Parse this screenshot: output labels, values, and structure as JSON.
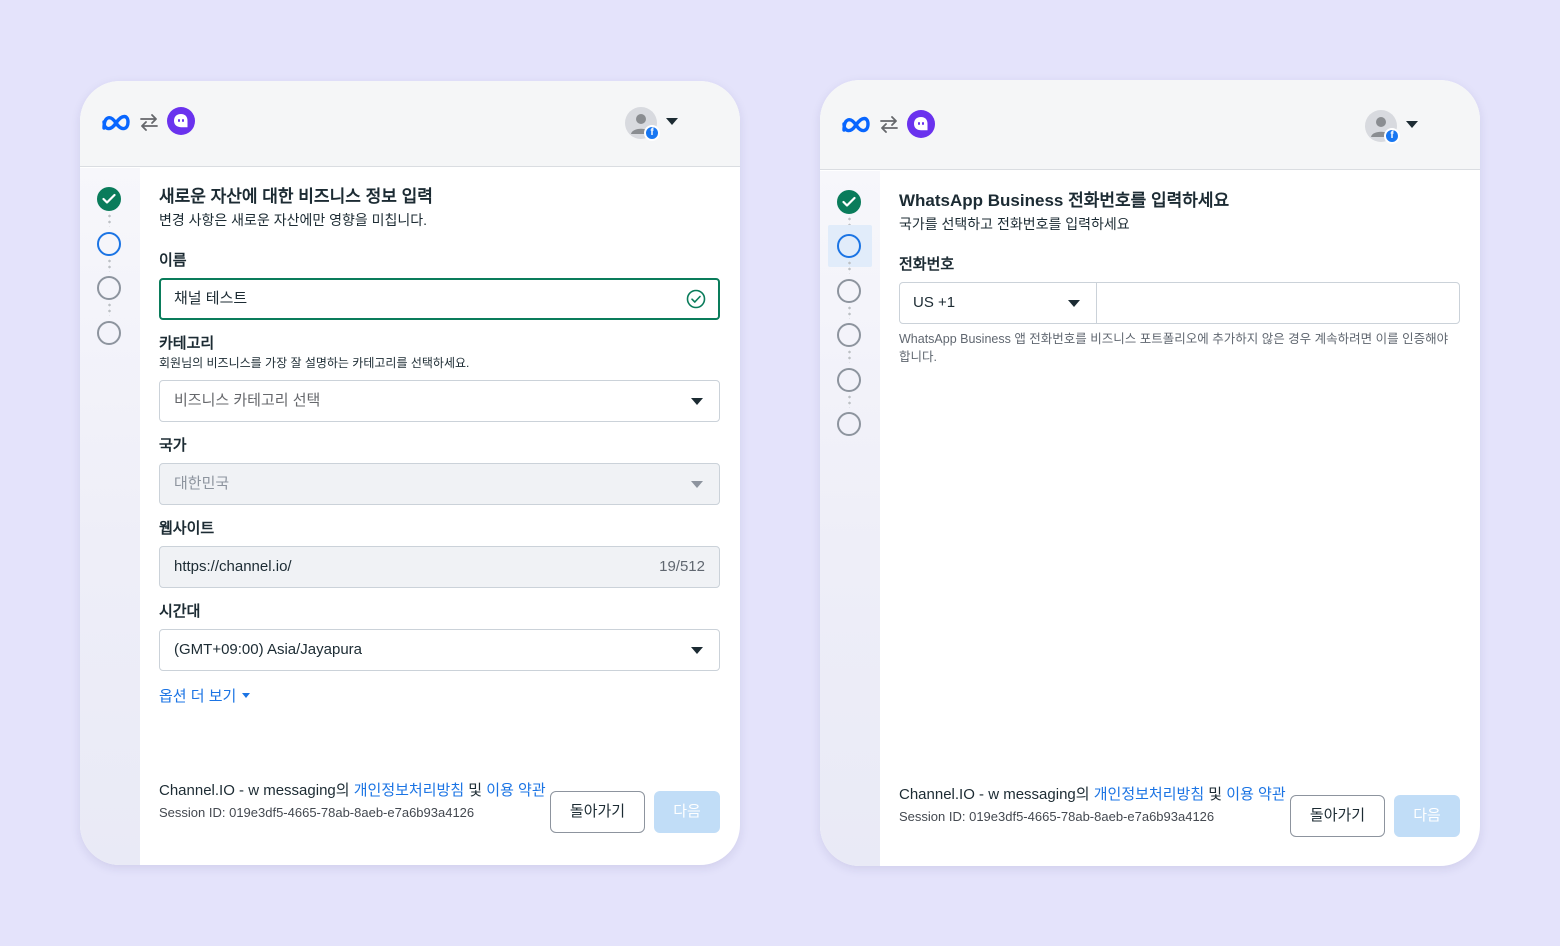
{
  "colors": {
    "background": "#e4e3fb",
    "accent_blue": "#1b74e4",
    "success_green": "#0a7c5b",
    "disabled_button": "#c1ddf7",
    "channel_purple": "#6a32ee"
  },
  "icons": [
    "meta-logo-icon",
    "swap-arrows-icon",
    "channel-talk-icon",
    "account-avatar-icon",
    "facebook-badge-icon",
    "chevron-down-icon",
    "check-circle-icon"
  ],
  "left_window": {
    "stepper": {
      "steps": [
        "done",
        "current",
        "pending",
        "pending"
      ]
    },
    "title": "새로운 자산에 대한 비즈니스 정보 입력",
    "subtitle": "변경 사항은 새로운 자산에만 영향을 미칩니다.",
    "name": {
      "label": "이름",
      "value": "채널 테스트"
    },
    "category": {
      "label": "카테고리",
      "helper": "회원님의 비즈니스를 가장 잘 설명하는 카테고리를 선택하세요.",
      "placeholder": "비즈니스 카테고리 선택"
    },
    "country": {
      "label": "국가",
      "value": "대한민국"
    },
    "website": {
      "label": "웹사이트",
      "value": "https://channel.io/",
      "counter": "19/512"
    },
    "timezone": {
      "label": "시간대",
      "value": "(GMT+09:00) Asia/Jayapura"
    },
    "more_options": "옵션 더 보기",
    "footer": {
      "consent_prefix": "Channel.IO - w messaging의 ",
      "privacy_link": "개인정보처리방침",
      "conjunction": " 및 ",
      "terms_link": "이용 약관",
      "session": "Session ID: 019e3df5-4665-78ab-8aeb-e7a6b93a4126",
      "back_button": "돌아가기",
      "next_button": "다음"
    }
  },
  "right_window": {
    "stepper": {
      "steps": [
        "done",
        "current",
        "pending",
        "pending",
        "pending",
        "pending"
      ]
    },
    "title": "WhatsApp Business 전화번호를 입력하세요",
    "subtitle": "국가를 선택하고 전화번호를 입력하세요",
    "phone": {
      "label": "전화번호",
      "country_code": "US +1",
      "number_value": "",
      "helper": "WhatsApp Business 앱 전화번호를 비즈니스 포트폴리오에 추가하지 않은 경우 계속하려면 이를 인증해야 합니다."
    },
    "footer": {
      "consent_prefix": "Channel.IO - w messaging의 ",
      "privacy_link": "개인정보처리방침",
      "conjunction": " 및 ",
      "terms_link": "이용 약관",
      "session": "Session ID: 019e3df5-4665-78ab-8aeb-e7a6b93a4126",
      "back_button": "돌아가기",
      "next_button": "다음"
    }
  }
}
